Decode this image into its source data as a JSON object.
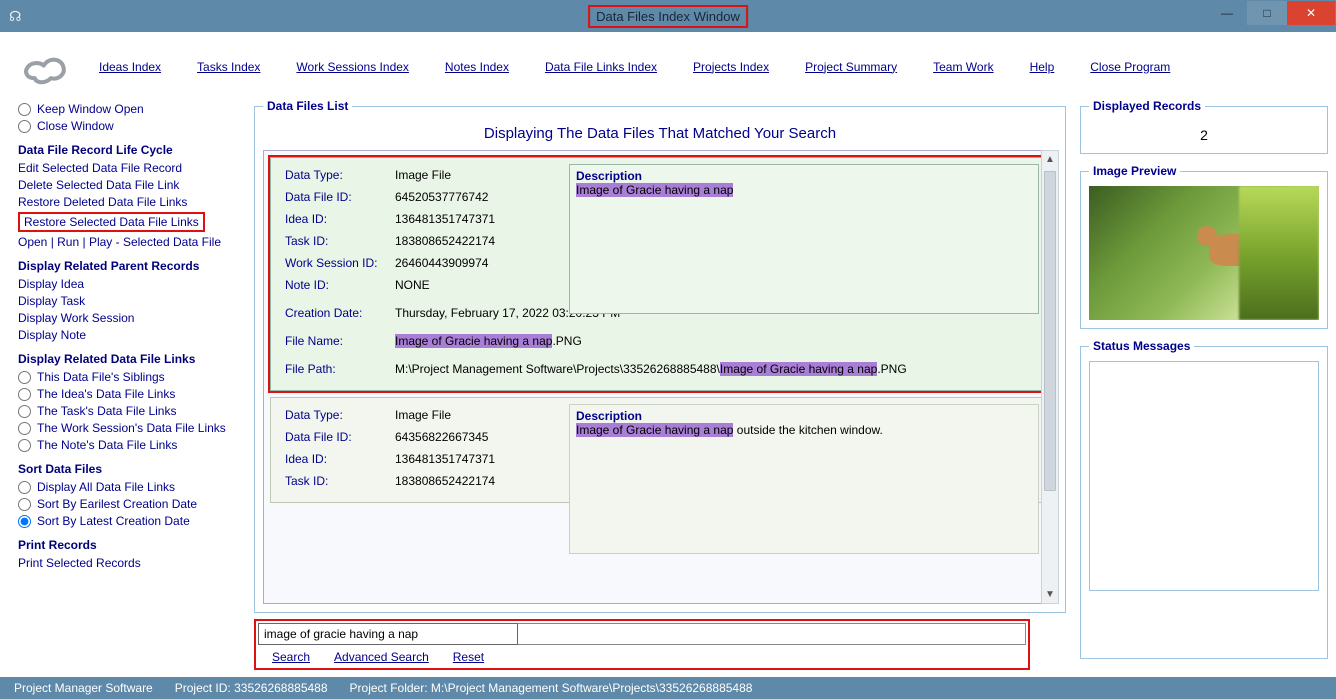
{
  "window": {
    "title": "Data Files Index Window"
  },
  "menu": {
    "ideas": "Ideas Index",
    "tasks": "Tasks Index",
    "work": "Work Sessions Index",
    "notes": "Notes Index",
    "dfl": "Data File Links Index",
    "projects": "Projects Index",
    "summary": "Project Summary",
    "team": "Team Work",
    "help": "Help",
    "close": "Close Program"
  },
  "sidebar": {
    "keep_open": "Keep Window Open",
    "close_win": "Close Window",
    "lifecycle_h": "Data File Record Life Cycle",
    "lc_edit": "Edit Selected Data File Record",
    "lc_delete": "Delete Selected Data File Link",
    "lc_restore_del": "Restore Deleted Data File Links",
    "lc_restore_sel": "Restore Selected Data File Links",
    "lc_open": "Open | Run | Play - Selected Data File",
    "parent_h": "Display Related Parent Records",
    "p_idea": "Display Idea",
    "p_task": "Display Task",
    "p_ws": "Display Work Session",
    "p_note": "Display Note",
    "dfl_h": "Display Related Data File Links",
    "r_siblings": "This Data File's Siblings",
    "r_idea": "The Idea's Data File Links",
    "r_task": "The Task's Data File Links",
    "r_ws": "The Work Session's Data File Links",
    "r_note": "The Note's Data File Links",
    "sort_h": "Sort Data Files",
    "s_all": "Display All Data File Links",
    "s_earliest": "Sort By Earilest Creation Date",
    "s_latest": "Sort By Latest Creation Date",
    "print_h": "Print Records",
    "print_sel": "Print Selected Records"
  },
  "list": {
    "legend": "Data Files List",
    "heading": "Displaying The Data Files That Matched Your Search",
    "labels": {
      "dtype": "Data Type:",
      "dfid": "Data File ID:",
      "ideaid": "Idea ID:",
      "taskid": "Task ID:",
      "wsid": "Work Session ID:",
      "noteid": "Note ID:",
      "cdate": "Creation Date:",
      "fname": "File Name:",
      "fpath": "File Path:",
      "desc": "Description"
    },
    "records": [
      {
        "dtype": "Image File",
        "dfid": "64520537776742",
        "ideaid": "136481351747371",
        "taskid": "183808652422174",
        "wsid": "26460443909974",
        "noteid": "NONE",
        "cdate": "Thursday, February 17, 2022   03:20:23 PM",
        "fname_hl": "Image of Gracie having a nap",
        "fname_suffix": ".PNG",
        "fpath_pre": "M:\\Project Management Software\\Projects\\33526268885488\\",
        "fpath_hl": "Image of Gracie having a nap",
        "fpath_suffix": ".PNG",
        "desc_hl": "Image of Gracie having a nap",
        "desc_rest": ""
      },
      {
        "dtype": "Image File",
        "dfid": "64356822667345",
        "ideaid": "136481351747371",
        "taskid": "183808652422174",
        "desc_hl": "Image of Gracie having a nap",
        "desc_rest": " outside the kitchen window."
      }
    ]
  },
  "search": {
    "value": "image of gracie having a nap",
    "search": "Search",
    "adv": "Advanced Search",
    "reset": "Reset"
  },
  "right": {
    "disp_legend": "Displayed Records",
    "disp_count": "2",
    "preview_legend": "Image Preview",
    "status_legend": "Status Messages"
  },
  "footer": {
    "app": "Project Manager Software",
    "pid_label": "Project ID:",
    "pid": "33526268885488",
    "pfolder_label": "Project Folder:",
    "pfolder": "M:\\Project Management Software\\Projects\\33526268885488"
  }
}
